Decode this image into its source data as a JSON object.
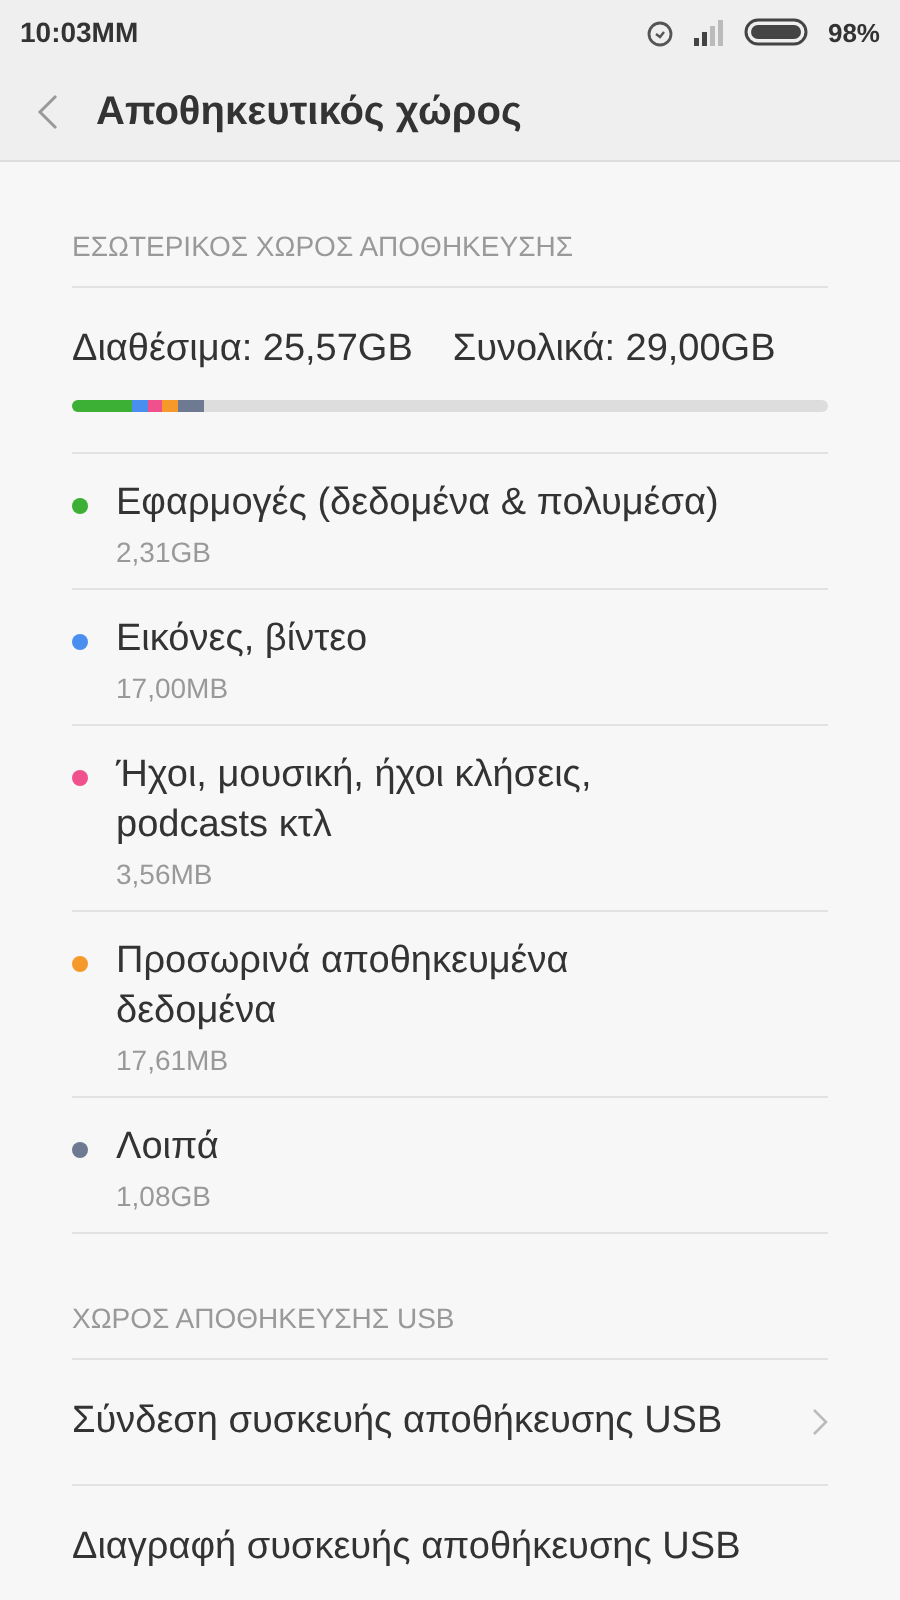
{
  "status_bar": {
    "time": "10:03MM",
    "battery": "98%"
  },
  "header": {
    "title": "Αποθηκευτικός χώρος"
  },
  "internal": {
    "heading": "ΕΣΩΤΕΡΙΚΟΣ ΧΩΡΟΣ ΑΠΟΘΗΚΕΥΣΗΣ",
    "available": "Διαθέσιμα: 25,57GB",
    "total": "Συνολικά: 29,00GB",
    "categories": [
      {
        "name": "Εφαρμογές (δεδομένα & πολυμέσα)",
        "size": "2,31GB",
        "color": "#3cb034"
      },
      {
        "name": "Εικόνες, βίντεο",
        "size": "17,00MB",
        "color": "#4a8ef0"
      },
      {
        "name": "Ήχοι, μουσική, ήχοι κλήσεις, podcasts κτλ",
        "size": "3,56MB",
        "color": "#f0508c"
      },
      {
        "name": "Προσωρινά αποθηκευμένα δεδομένα",
        "size": "17,61MB",
        "color": "#f59a2a"
      },
      {
        "name": "Λοιπά",
        "size": "1,08GB",
        "color": "#6e7a92"
      }
    ]
  },
  "usb": {
    "heading": "ΧΩΡΟΣ ΑΠΟΘΗΚΕΥΣΗΣ USB",
    "items": [
      {
        "label": "Σύνδεση συσκευής αποθήκευσης USB",
        "kind": "link"
      },
      {
        "label": "Διαγραφή συσκευής αποθήκευσης USB",
        "kind": "plain"
      }
    ]
  }
}
